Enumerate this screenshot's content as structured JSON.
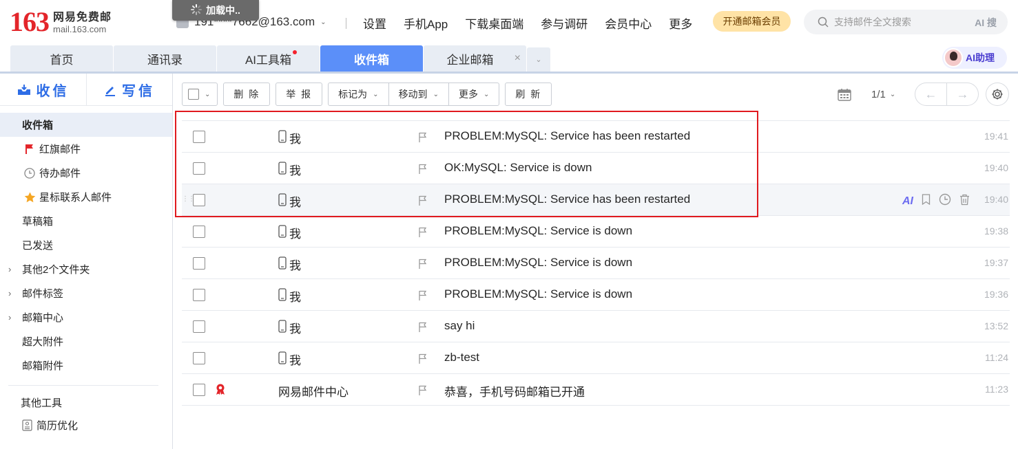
{
  "header": {
    "logo_number": "163",
    "logo_cn": "网易免费邮",
    "logo_domain": "mail.163.com",
    "loading_text": "加载中..",
    "account": "191****7662@163.com",
    "nav": [
      "设置",
      "手机App",
      "下载桌面端",
      "参与调研",
      "会员中心",
      "更多"
    ],
    "vip_button": "开通邮箱会员",
    "search_placeholder": "支持邮件全文搜索",
    "search_ai": "AI 搜"
  },
  "tabs": [
    {
      "label": "首页"
    },
    {
      "label": "通讯录"
    },
    {
      "label": "AI工具箱"
    },
    {
      "label": "收件箱"
    },
    {
      "label": "企业邮箱"
    }
  ],
  "ai_assistant": "AI助理",
  "sidebar": {
    "receive": "收信",
    "write": "写信",
    "items": {
      "inbox": "收件箱",
      "red_flag": "红旗邮件",
      "todo": "待办邮件",
      "star_contacts": "星标联系人邮件",
      "drafts": "草稿箱",
      "sent": "已发送",
      "other_folders": "其他2个文件夹",
      "labels": "邮件标签",
      "mail_center": "邮箱中心",
      "large_attach": "超大附件",
      "attachments": "邮箱附件"
    },
    "tools_title": "其他工具",
    "resume": "简历优化"
  },
  "toolbar": {
    "delete": "删 除",
    "report": "举 报",
    "mark_as": "标记为",
    "move_to": "移动到",
    "more": "更多",
    "refresh": "刷 新",
    "page": "1/1"
  },
  "mails": [
    {
      "sender": "我",
      "subject": "PROBLEM:MySQL: Service has been restarted",
      "time": "19:41"
    },
    {
      "sender": "我",
      "subject": "OK:MySQL: Service is down",
      "time": "19:40"
    },
    {
      "sender": "我",
      "subject": "PROBLEM:MySQL: Service has been restarted",
      "time": "19:40"
    },
    {
      "sender": "我",
      "subject": "PROBLEM:MySQL: Service is down",
      "time": "19:38"
    },
    {
      "sender": "我",
      "subject": "PROBLEM:MySQL: Service is down",
      "time": "19:37"
    },
    {
      "sender": "我",
      "subject": "PROBLEM:MySQL: Service is down",
      "time": "19:36"
    },
    {
      "sender": "我",
      "subject": "say hi",
      "time": "13:52"
    },
    {
      "sender": "我",
      "subject": "zb-test",
      "time": "11:24"
    },
    {
      "sender": "网易邮件中心",
      "subject": "恭喜，手机号码邮箱已开通",
      "time": "11:23"
    }
  ],
  "row_actions_ai": "AI",
  "colors": {
    "accent": "#5b8ff9",
    "brand_red": "#e3252a",
    "highlight": "#e0191e"
  }
}
